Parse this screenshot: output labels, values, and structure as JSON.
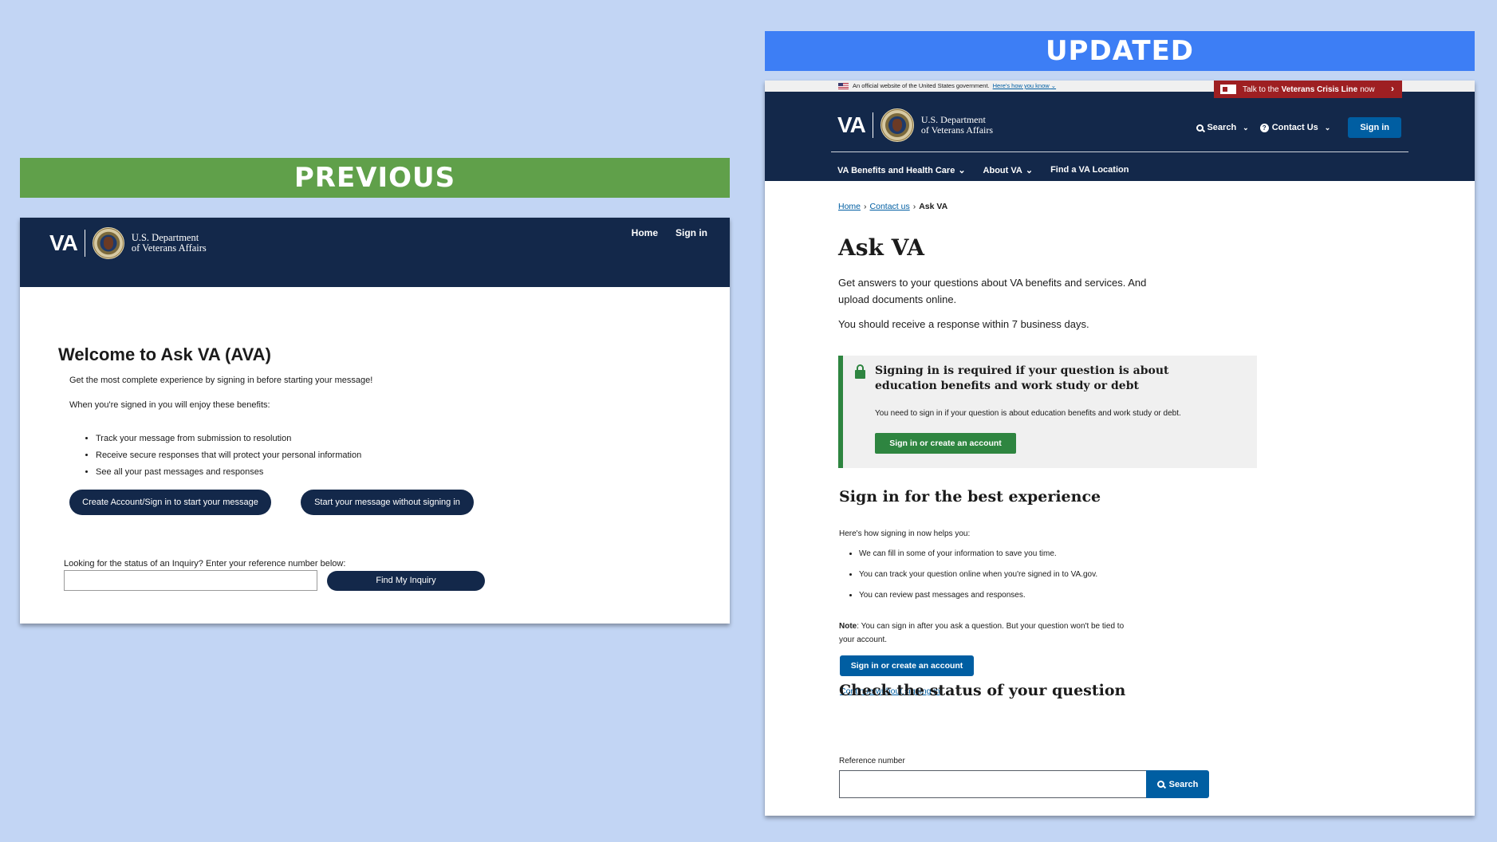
{
  "previous": {
    "label": "PREVIOUS",
    "header": {
      "va_mark": "VA",
      "dept_line1": "U.S. Department",
      "dept_line2": "of Veterans Affairs",
      "nav": {
        "home": "Home",
        "signin": "Sign in"
      }
    },
    "title": "Welcome to Ask VA (AVA)",
    "intro": "Get the most complete experience by signing in before starting your message!",
    "benefits_intro": "When you're signed in you will enjoy these benefits:",
    "benefits": [
      "Track your message from submission to resolution",
      "Receive secure responses that will protect your personal information",
      "See all your past messages and responses"
    ],
    "button_signin": "Create Account/Sign in to start your message",
    "button_nosignin": "Start your message without signing in",
    "ref_label": "Looking for the status of an Inquiry? Enter your reference number below:",
    "ref_value": "",
    "button_find": "Find My Inquiry"
  },
  "updated": {
    "label": "UPDATED",
    "gov_banner": {
      "text": "An official website of the United States government.",
      "link": "Here's how you know"
    },
    "crisis": {
      "pre": "Talk to the",
      "bold": "Veterans Crisis Line",
      "post": "now"
    },
    "header": {
      "va_mark": "VA",
      "dept_line1": "U.S. Department",
      "dept_line2": "of Veterans Affairs",
      "search": "Search",
      "contact": "Contact Us",
      "signin": "Sign in",
      "nav": [
        "VA Benefits and Health Care",
        "About VA",
        "Find a VA Location"
      ]
    },
    "breadcrumb": [
      "Home",
      "Contact us",
      "Ask VA"
    ],
    "title": "Ask VA",
    "intro": "Get answers to your questions about VA benefits and services. And upload documents online.",
    "response_time": "You should receive a response within 7 business days.",
    "alert": {
      "title": "Signing in is required  if your question is about education benefits and work study or debt",
      "text": "You need to sign in if your question is about education benefits and work study or debt.",
      "button": "Sign in or create an account"
    },
    "best_experience": {
      "heading": "Sign in for the best experience",
      "intro": "Here's how signing in now helps you:",
      "items": [
        "We can fill in some of your information to save you time.",
        "You can track your question online when you're signed in to VA.gov.",
        "You can review past messages and responses."
      ],
      "note_label": "Note",
      "note_text": ": You can sign in after you ask a question. But your question won't be tied to your account.",
      "button": "Sign in or create an account",
      "continue_link": "Continue without signing in"
    },
    "status": {
      "heading": "Check the status of your question",
      "ref_label": "Reference number",
      "ref_value": "",
      "button": "Search"
    }
  },
  "colors": {
    "background": "#c2d5f4",
    "previous_label": "#60a04a",
    "updated_label": "#3d7ef5",
    "va_navy": "#13284a",
    "va_blue": "#005ea2",
    "va_green": "#2e8540",
    "crisis_red": "#9e1f22"
  }
}
